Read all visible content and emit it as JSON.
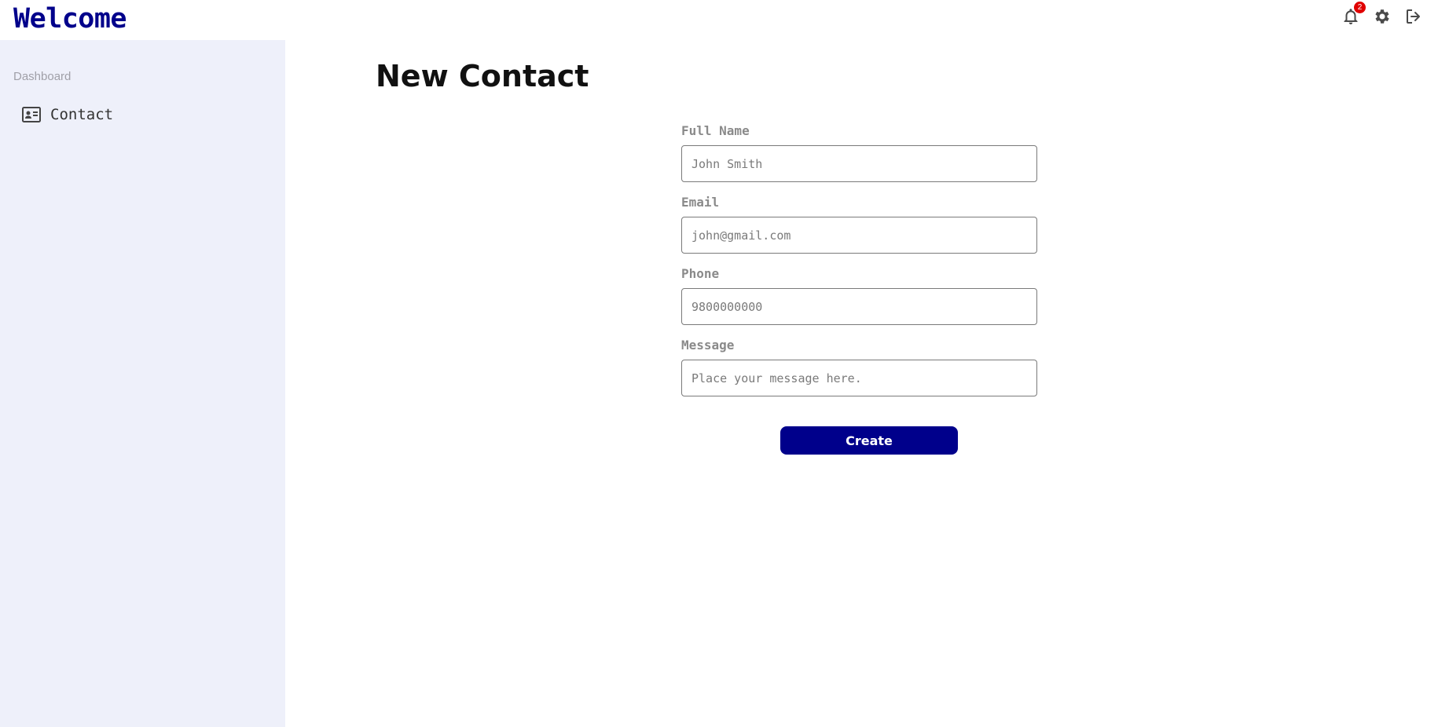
{
  "header": {
    "brand": "Welcome",
    "notification_count": "2",
    "icons": [
      "bell-icon",
      "gear-icon",
      "logout-icon"
    ]
  },
  "sidebar": {
    "section_label": "Dashboard",
    "items": [
      {
        "label": "Contact",
        "icon": "contact-card-icon"
      }
    ]
  },
  "main": {
    "title": "New Contact",
    "form": {
      "full_name": {
        "label": "Full Name",
        "placeholder": "John Smith",
        "value": ""
      },
      "email": {
        "label": "Email",
        "placeholder": "john@gmail.com",
        "value": ""
      },
      "phone": {
        "label": "Phone",
        "placeholder": "9800000000",
        "value": ""
      },
      "message": {
        "label": "Message",
        "placeholder": "Place your message here.",
        "value": ""
      },
      "submit_label": "Create"
    }
  },
  "colors": {
    "brand": "#00008b",
    "sidebar_bg": "#eef0fa",
    "badge": "#e00000"
  }
}
